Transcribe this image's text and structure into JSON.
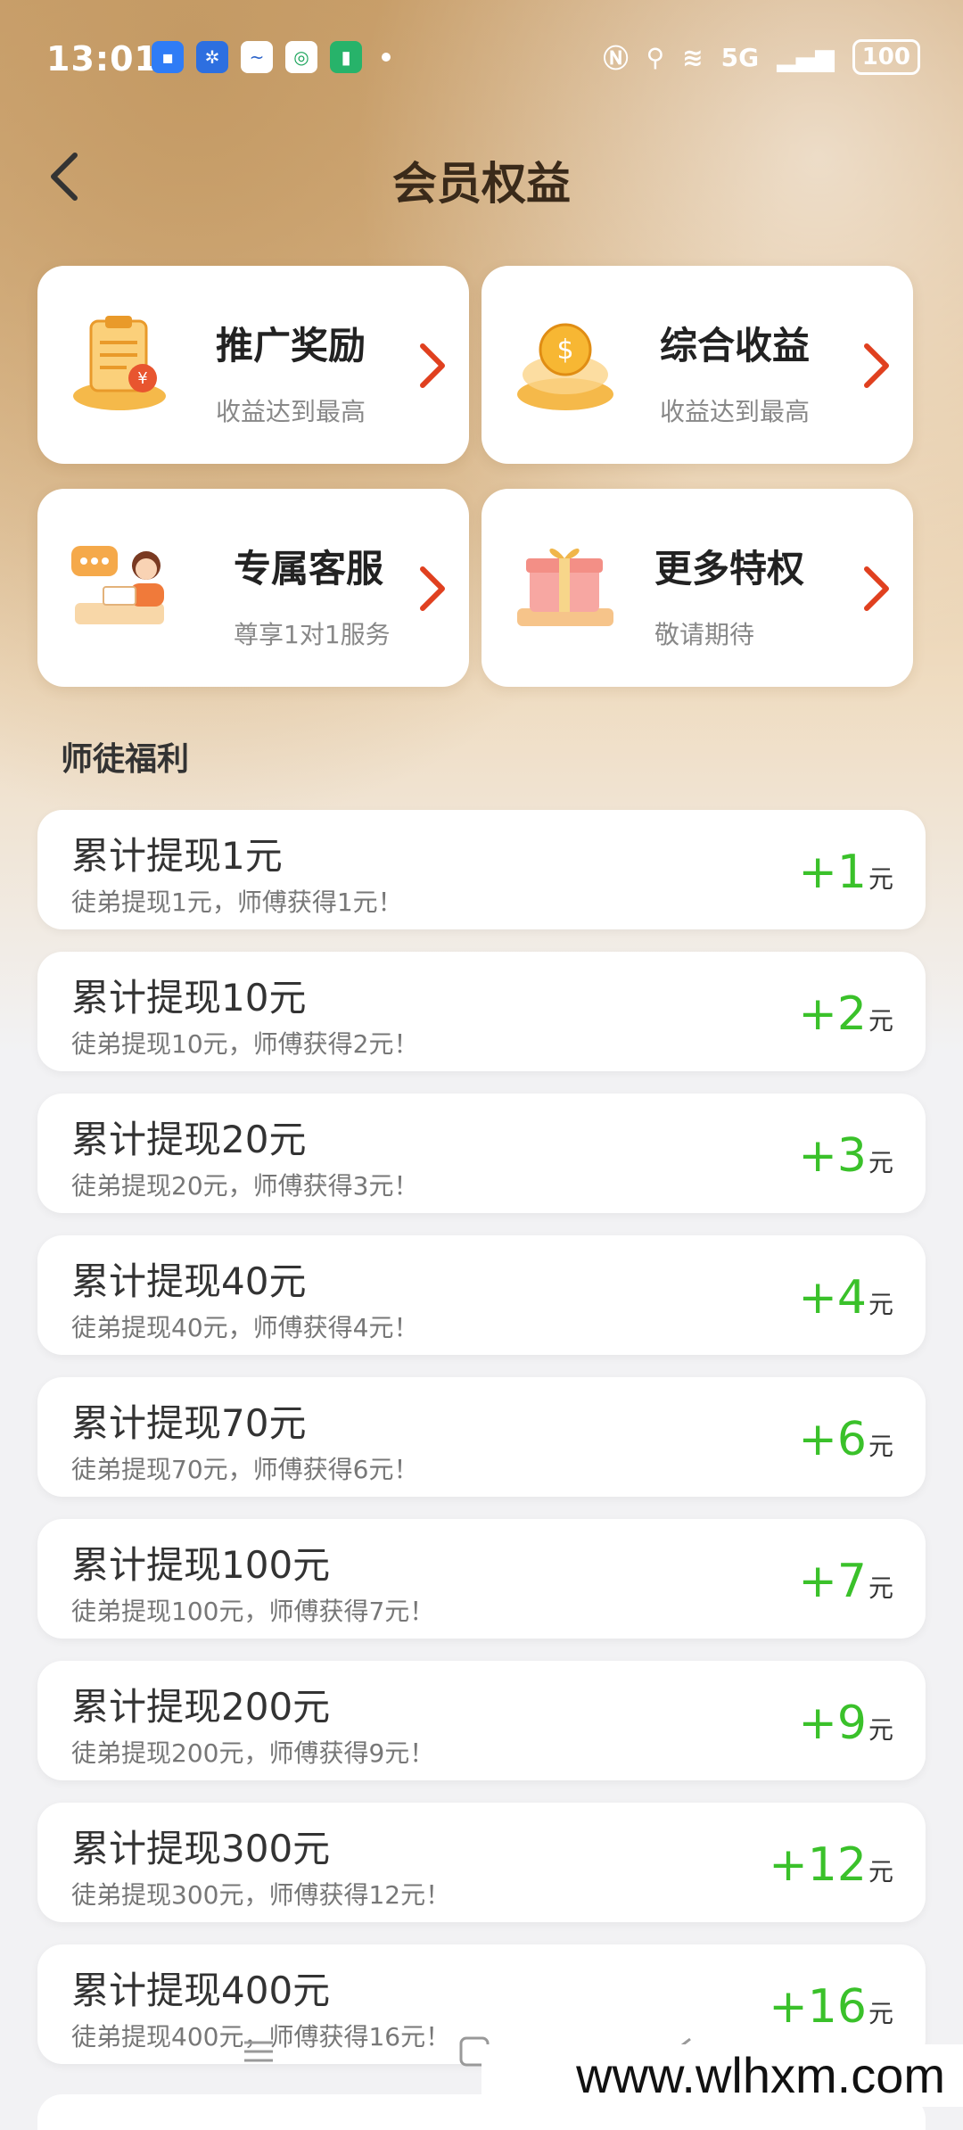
{
  "status_bar": {
    "time": "13:01",
    "network": "5G",
    "battery": "100"
  },
  "header": {
    "title": "会员权益"
  },
  "cards": [
    {
      "title": "推广奖励",
      "subtitle": "收益达到最高",
      "icon": "clipboard-coin-icon"
    },
    {
      "title": "综合收益",
      "subtitle": "收益达到最高",
      "icon": "dollar-coin-icon"
    },
    {
      "title": "专属客服",
      "subtitle": "尊享1对1服务",
      "icon": "customer-service-icon"
    },
    {
      "title": "更多特权",
      "subtitle": "敬请期待",
      "icon": "gift-box-icon"
    }
  ],
  "section": {
    "title": "师徒福利"
  },
  "rewards": [
    {
      "title": "累计提现1元",
      "desc": "徒弟提现1元，师傅获得1元！",
      "amount": "+1",
      "unit": "元"
    },
    {
      "title": "累计提现10元",
      "desc": "徒弟提现10元，师傅获得2元！",
      "amount": "+2",
      "unit": "元"
    },
    {
      "title": "累计提现20元",
      "desc": "徒弟提现20元，师傅获得3元！",
      "amount": "+3",
      "unit": "元"
    },
    {
      "title": "累计提现40元",
      "desc": "徒弟提现40元，师傅获得4元！",
      "amount": "+4",
      "unit": "元"
    },
    {
      "title": "累计提现70元",
      "desc": "徒弟提现70元，师傅获得6元！",
      "amount": "+6",
      "unit": "元"
    },
    {
      "title": "累计提现100元",
      "desc": "徒弟提现100元，师傅获得7元！",
      "amount": "+7",
      "unit": "元"
    },
    {
      "title": "累计提现200元",
      "desc": "徒弟提现200元，师傅获得9元！",
      "amount": "+9",
      "unit": "元"
    },
    {
      "title": "累计提现300元",
      "desc": "徒弟提现300元，师傅获得12元！",
      "amount": "+12",
      "unit": "元"
    },
    {
      "title": "累计提现400元",
      "desc": "徒弟提现400元，师傅获得16元！",
      "amount": "+16",
      "unit": "元"
    }
  ],
  "watermark": "www.wlhxm.com",
  "colors": {
    "accent_green": "#3ac12a",
    "chevron_red": "#e0401f",
    "gold": "#cfa674"
  }
}
